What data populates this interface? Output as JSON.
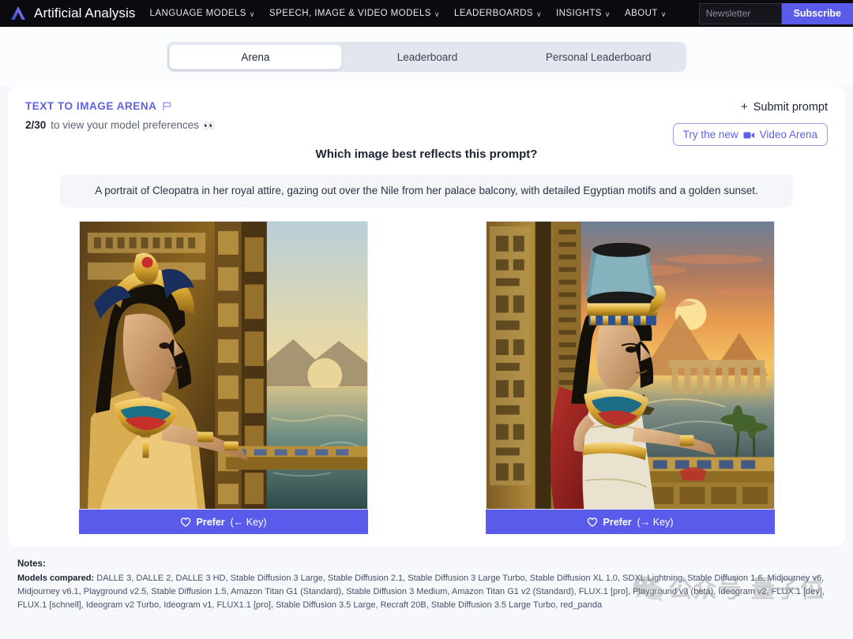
{
  "header": {
    "logo_icon": "artificial-analysis-logo",
    "brand": "Artificial Analysis",
    "nav": [
      {
        "label": "LANGUAGE MODELS",
        "caret": "∨"
      },
      {
        "label": "SPEECH, IMAGE & VIDEO MODELS",
        "caret": "∨"
      },
      {
        "label": "LEADERBOARDS",
        "caret": "∨"
      },
      {
        "label": "INSIGHTS",
        "caret": "∨"
      },
      {
        "label": "ABOUT",
        "caret": "∨"
      }
    ],
    "newsletter_placeholder": "Newsletter",
    "newsletter_value": "",
    "subscribe_label": "Subscribe",
    "accent_color": "#5a5bea",
    "background_color": "#0b0b0f"
  },
  "tabs": [
    {
      "label": "Arena",
      "active": true
    },
    {
      "label": "Leaderboard",
      "active": false
    },
    {
      "label": "Personal Leaderboard",
      "active": false
    }
  ],
  "arena": {
    "title": "TEXT TO IMAGE ARENA",
    "flag_icon": "flag-icon",
    "counter": "2/30",
    "counter_suffix": "to view your model preferences",
    "eyes_icon": "👀",
    "submit_prompt_label": "Submit prompt",
    "plus_icon": "+",
    "video_arena_prefix": "Try the new",
    "video_arena_suffix": "Video Arena",
    "camera_icon": "video-camera-icon",
    "question": "Which image best reflects this prompt?",
    "prompt": "A portrait of Cleopatra in her royal attire, gazing out over the Nile from her palace balcony, with detailed Egyptian motifs and a golden sunset.",
    "title_color": "#5f61e6"
  },
  "choices": [
    {
      "id": "left",
      "alt": "Cleopatra in profile wearing golden winged headdress beside carved hieroglyph columns overlooking the Nile at sunset",
      "prefer_label": "Prefer",
      "key_hint": "(← Key)"
    },
    {
      "id": "right",
      "alt": "Cleopatra in tall blue crown and red cape standing on a palace balcony above the Nile with pyramids and golden sunset",
      "prefer_label": "Prefer",
      "key_hint": "(→ Key)"
    }
  ],
  "notes": {
    "title": "Notes:",
    "models_label": "Models compared:",
    "models_text": "DALLE 3, DALLE 2, DALLE 3 HD, Stable Diffusion 3 Large, Stable Diffusion 2.1, Stable Diffusion 3 Large Turbo, Stable Diffusion XL 1.0, SDXL Lightning, Stable Diffusion 1.6, Midjourney v6, Midjourney v6.1, Playground v2.5, Stable Diffusion 1.5, Amazon Titan G1 (Standard), Stable Diffusion 3 Medium, Amazon Titan G1 v2 (Standard), FLUX.1 [pro], Playground v3 (beta), Ideogram v2, FLUX.1 [dev], FLUX.1 [schnell], Ideogram v2 Turbo, Ideogram v1, FLUX1.1 [pro], Stable Diffusion 3.5 Large, Recraft 20B, Stable Diffusion 3.5 Large Turbo, red_panda"
  },
  "watermark": {
    "wechat_icon": "wechat-icon",
    "text": "公众号 量子位"
  }
}
